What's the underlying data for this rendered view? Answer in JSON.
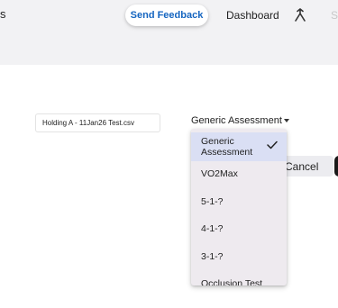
{
  "header": {
    "left_fragment": "s",
    "feedback_label": "Send Feedback",
    "dashboard_label": "Dashboard",
    "faded_fragment": "Se"
  },
  "form": {
    "file_name": "Holding A - 11Jan26 Test.csv",
    "select_value": "Generic Assessment"
  },
  "actions": {
    "cancel_label": "Cancel"
  },
  "dropdown": {
    "options": [
      {
        "label_line1": "Generic",
        "label_line2": "Assessment",
        "selected": true
      },
      {
        "label": "VO2Max"
      },
      {
        "label": "5-1-?"
      },
      {
        "label": "4-1-?"
      },
      {
        "label": "3-1-?"
      },
      {
        "label": "Occlusion Test"
      }
    ]
  },
  "colors": {
    "accent": "#1565c0",
    "topbar_bg": "#f2f2f4",
    "menu_bg": "#eeeaef",
    "selected_bg": "#dadff4"
  },
  "icons": {
    "merge": "merge-icon",
    "check": "check-icon"
  }
}
